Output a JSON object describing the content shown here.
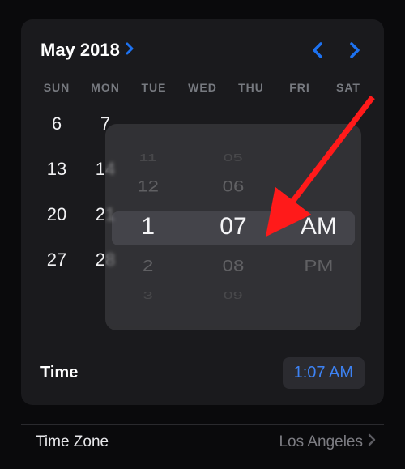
{
  "header": {
    "month_year": "May 2018"
  },
  "weekdays": [
    "SUN",
    "MON",
    "TUE",
    "WED",
    "THU",
    "FRI",
    "SAT"
  ],
  "visible_dates": [
    "6",
    "7",
    "",
    "",
    "",
    "",
    "",
    "13",
    "14",
    "",
    "",
    "",
    "",
    "",
    "20",
    "21",
    "",
    "",
    "",
    "",
    "",
    "27",
    "28",
    "",
    "",
    "",
    "",
    ""
  ],
  "picker": {
    "hours": {
      "minus2": "11",
      "minus1": "12",
      "sel": "1",
      "plus1": "2",
      "plus2": "3"
    },
    "minutes": {
      "minus2": "05",
      "minus1": "06",
      "sel": "07",
      "plus1": "08",
      "plus2": "09"
    },
    "period": {
      "sel": "AM",
      "plus1": "PM"
    }
  },
  "time_row": {
    "label": "Time",
    "value": "1:07 AM"
  },
  "timezone_row": {
    "label": "Time Zone",
    "value": "Los Angeles"
  },
  "colors": {
    "accent": "#1d72f1"
  }
}
